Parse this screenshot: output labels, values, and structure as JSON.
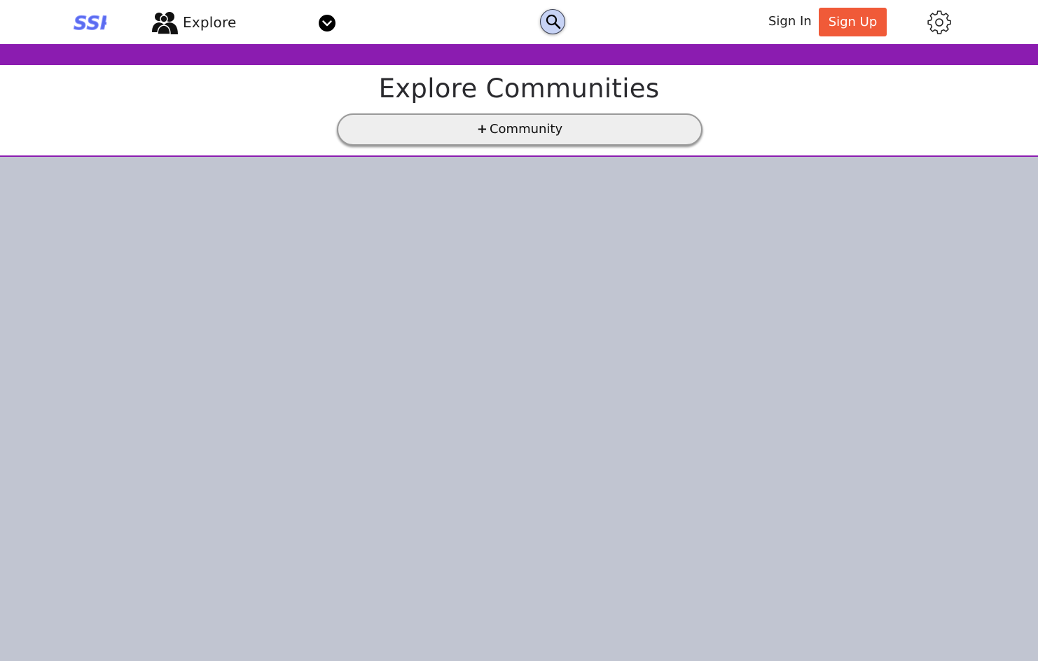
{
  "nav": {
    "logo_text": "SSP",
    "explore_label": "Explore",
    "signin_label": "Sign In",
    "signup_label": "Sign Up"
  },
  "main": {
    "title": "Explore Communities",
    "add_symbol": "+",
    "add_label": "Community"
  },
  "colors": {
    "accent_purple": "#8b1cb0",
    "signup_orange": "#f05a38",
    "logo_blue": "#5b6cf0",
    "page_background": "#c1c5d1"
  },
  "icons": {
    "logo": "ssp-logo",
    "explore": "people-icon",
    "dropdown": "chevron-down-icon",
    "search": "search-icon",
    "settings": "gear-icon"
  }
}
